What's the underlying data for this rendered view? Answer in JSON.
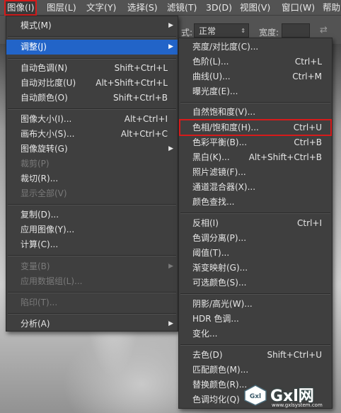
{
  "menubar": {
    "items": [
      "图像(I)",
      "图层(L)",
      "文字(Y)",
      "选择(S)",
      "滤镜(T)",
      "3D(D)",
      "视图(V)",
      "窗口(W)",
      "帮助"
    ]
  },
  "options_bar": {
    "mode_label": "式:",
    "mode_value": "正常",
    "right_label": "宽度:"
  },
  "image_menu": {
    "items": [
      {
        "label": "模式(M)",
        "shortcut": "",
        "submenu": true,
        "disabled": false
      },
      {
        "label": "调整(J)",
        "shortcut": "",
        "submenu": true,
        "disabled": false,
        "highlighted": true
      },
      {
        "label": "自动色调(N)",
        "shortcut": "Shift+Ctrl+L",
        "disabled": false
      },
      {
        "label": "自动对比度(U)",
        "shortcut": "Alt+Shift+Ctrl+L",
        "disabled": false
      },
      {
        "label": "自动颜色(O)",
        "shortcut": "Shift+Ctrl+B",
        "disabled": false
      },
      {
        "label": "图像大小(I)...",
        "shortcut": "Alt+Ctrl+I",
        "disabled": false
      },
      {
        "label": "画布大小(S)...",
        "shortcut": "Alt+Ctrl+C",
        "disabled": false
      },
      {
        "label": "图像旋转(G)",
        "shortcut": "",
        "submenu": true,
        "disabled": false
      },
      {
        "label": "裁剪(P)",
        "shortcut": "",
        "disabled": true
      },
      {
        "label": "裁切(R)...",
        "shortcut": "",
        "disabled": false
      },
      {
        "label": "显示全部(V)",
        "shortcut": "",
        "disabled": true
      },
      {
        "label": "复制(D)...",
        "shortcut": "",
        "disabled": false
      },
      {
        "label": "应用图像(Y)...",
        "shortcut": "",
        "disabled": false
      },
      {
        "label": "计算(C)...",
        "shortcut": "",
        "disabled": false
      },
      {
        "label": "变量(B)",
        "shortcut": "",
        "submenu": true,
        "disabled": true
      },
      {
        "label": "应用数据组(L)...",
        "shortcut": "",
        "disabled": true
      },
      {
        "label": "陷印(T)...",
        "shortcut": "",
        "disabled": true
      },
      {
        "label": "分析(A)",
        "shortcut": "",
        "submenu": true,
        "disabled": false
      }
    ]
  },
  "adjust_menu": {
    "items": [
      {
        "label": "亮度/对比度(C)...",
        "shortcut": ""
      },
      {
        "label": "色阶(L)...",
        "shortcut": "Ctrl+L"
      },
      {
        "label": "曲线(U)...",
        "shortcut": "Ctrl+M"
      },
      {
        "label": "曝光度(E)...",
        "shortcut": ""
      },
      {
        "label": "自然饱和度(V)...",
        "shortcut": ""
      },
      {
        "label": "色相/饱和度(H)...",
        "shortcut": "Ctrl+U",
        "boxed": true
      },
      {
        "label": "色彩平衡(B)...",
        "shortcut": "Ctrl+B"
      },
      {
        "label": "黑白(K)...",
        "shortcut": "Alt+Shift+Ctrl+B"
      },
      {
        "label": "照片滤镜(F)...",
        "shortcut": ""
      },
      {
        "label": "通道混合器(X)...",
        "shortcut": ""
      },
      {
        "label": "颜色查找...",
        "shortcut": ""
      },
      {
        "label": "反相(I)",
        "shortcut": "Ctrl+I"
      },
      {
        "label": "色调分离(P)...",
        "shortcut": ""
      },
      {
        "label": "阈值(T)...",
        "shortcut": ""
      },
      {
        "label": "渐变映射(G)...",
        "shortcut": ""
      },
      {
        "label": "可选颜色(S)...",
        "shortcut": ""
      },
      {
        "label": "阴影/高光(W)...",
        "shortcut": ""
      },
      {
        "label": "HDR 色调...",
        "shortcut": ""
      },
      {
        "label": "变化...",
        "shortcut": ""
      },
      {
        "label": "去色(D)",
        "shortcut": "Shift+Ctrl+U"
      },
      {
        "label": "匹配颜色(M)...",
        "shortcut": ""
      },
      {
        "label": "替换颜色(R)...",
        "shortcut": ""
      },
      {
        "label": "色调均化(Q)",
        "shortcut": ""
      }
    ]
  },
  "watermark": {
    "logo_text": "Gxl",
    "brand": "Gxl网",
    "url": "www.gxlsystem.com"
  },
  "colors": {
    "highlight": "#2264c8",
    "annotation_box": "#d61b1b",
    "menu_bg": "#3f3f3f"
  }
}
